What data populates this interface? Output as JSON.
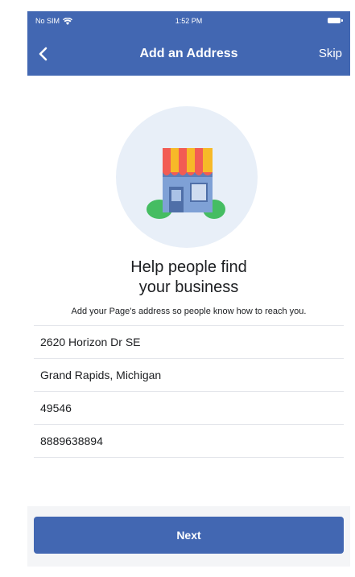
{
  "status_bar": {
    "carrier": "No SIM",
    "time": "1:52 PM"
  },
  "nav": {
    "title": "Add an Address",
    "skip_label": "Skip",
    "back_icon": "chevron-left-icon"
  },
  "intro": {
    "illustration": "storefront-icon",
    "headline_line1": "Help people find",
    "headline_line2": "your business",
    "subtext": "Add your Page's address so people know how to reach you."
  },
  "address_fields": [
    {
      "value": "2620 Horizon Dr SE"
    },
    {
      "value": "Grand Rapids, Michigan"
    },
    {
      "value": "49546"
    },
    {
      "value": "8889638894"
    }
  ],
  "next_button": {
    "label": "Next"
  },
  "colors": {
    "brand_blue": "#4267b2",
    "background": "#f4f5f7",
    "illustration_bg": "#e8eff8",
    "awning_red": "#f25c54",
    "awning_yellow": "#f7b928",
    "shop_blue": "#7fa1d6",
    "bush_green": "#45bd62"
  }
}
